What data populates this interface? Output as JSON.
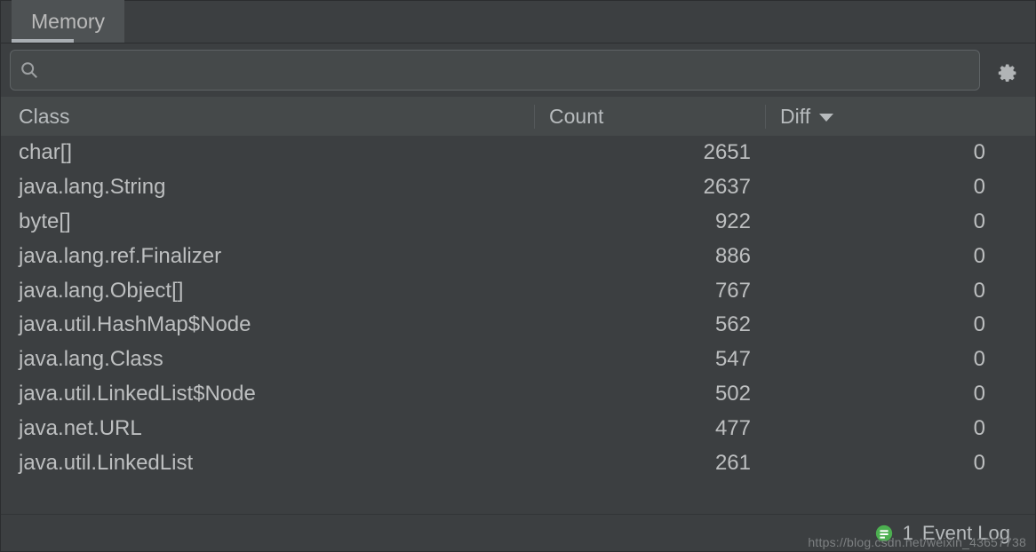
{
  "tab": {
    "label": "Memory"
  },
  "search": {
    "value": ""
  },
  "columns": {
    "class": "Class",
    "count": "Count",
    "diff": "Diff"
  },
  "sort": {
    "column": "diff",
    "direction": "desc"
  },
  "rows": [
    {
      "class": "char[]",
      "count": 2651,
      "diff": 0
    },
    {
      "class": "java.lang.String",
      "count": 2637,
      "diff": 0
    },
    {
      "class": "byte[]",
      "count": 922,
      "diff": 0
    },
    {
      "class": "java.lang.ref.Finalizer",
      "count": 886,
      "diff": 0
    },
    {
      "class": "java.lang.Object[]",
      "count": 767,
      "diff": 0
    },
    {
      "class": "java.util.HashMap$Node",
      "count": 562,
      "diff": 0
    },
    {
      "class": "java.lang.Class",
      "count": 547,
      "diff": 0
    },
    {
      "class": "java.util.LinkedList$Node",
      "count": 502,
      "diff": 0
    },
    {
      "class": "java.net.URL",
      "count": 477,
      "diff": 0
    },
    {
      "class": "java.util.LinkedList",
      "count": 261,
      "diff": 0
    }
  ],
  "status": {
    "event_count": "1",
    "event_label": "Event Log"
  },
  "watermark": "https://blog.csdn.net/weixin_43657738"
}
